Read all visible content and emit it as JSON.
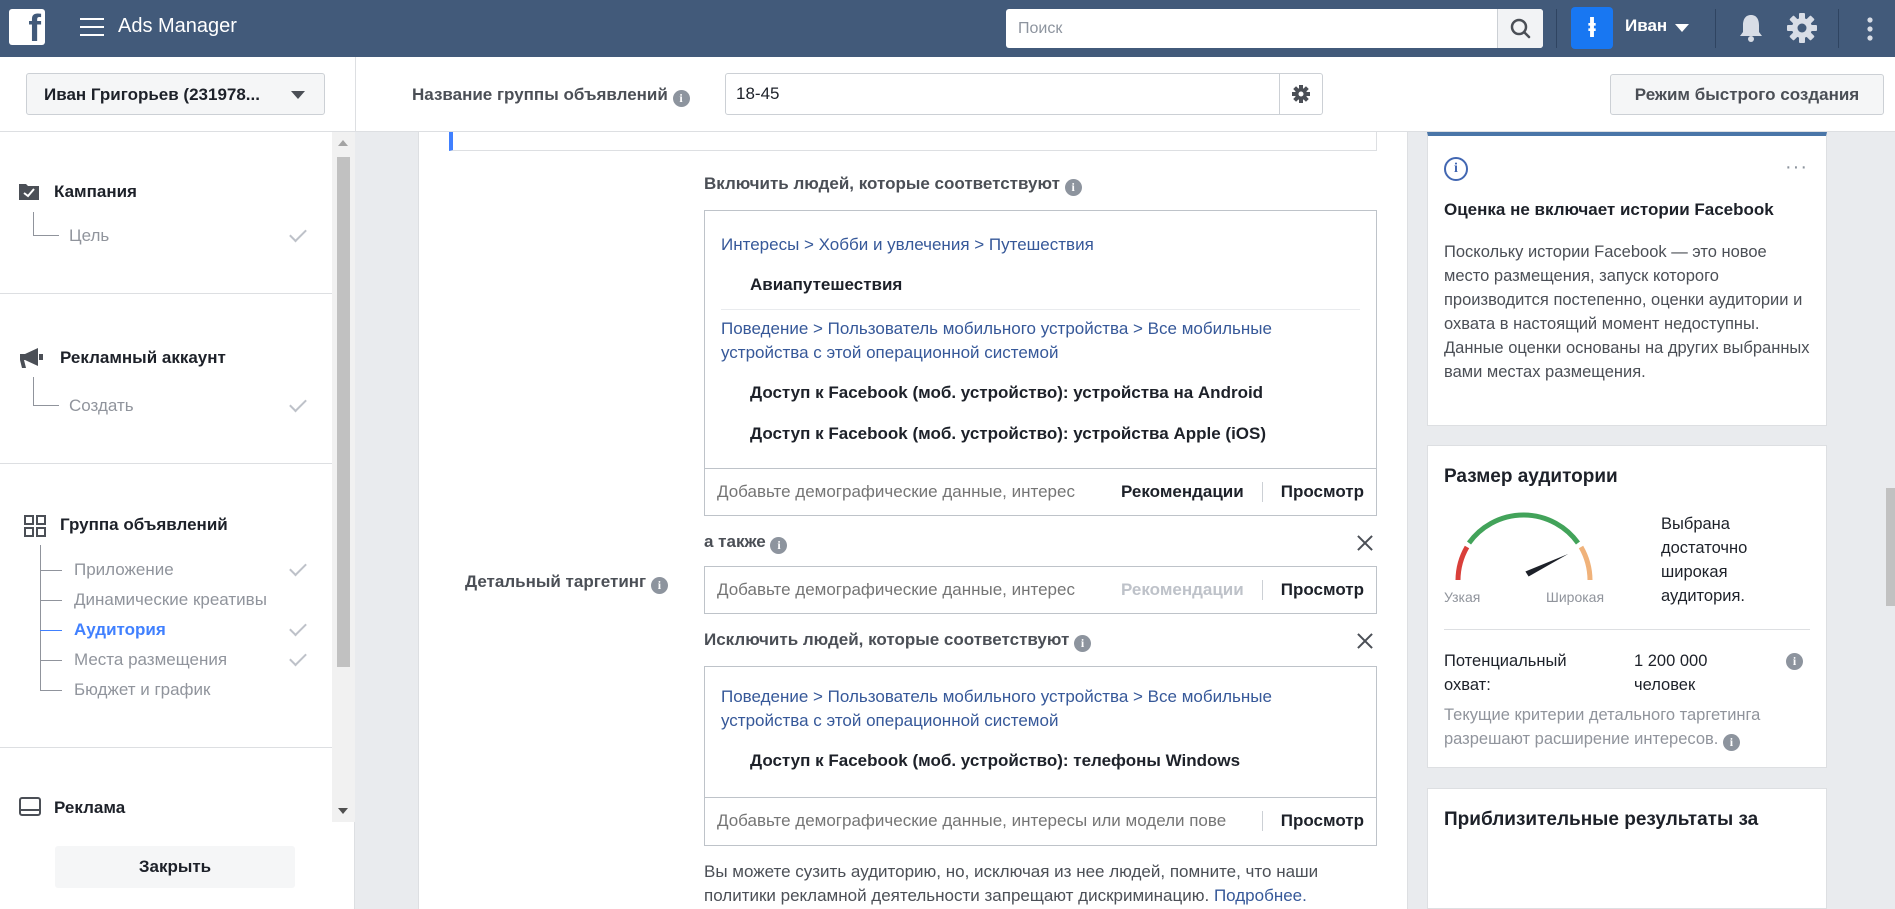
{
  "topbar": {
    "logo": "f",
    "app_title": "Ads Manager",
    "search_placeholder": "Поиск",
    "avatar_glyph": "ⱡ",
    "user_name": "Иван"
  },
  "subheader": {
    "account": "Иван Григорьев (231978...",
    "group_name_label": "Название группы объявлений",
    "group_name_value": "18-45",
    "quick_create": "Режим быстрого создания"
  },
  "sidebar": {
    "campaign": {
      "title": "Кампания",
      "items": [
        "Цель"
      ]
    },
    "ad_account": {
      "title": "Рекламный аккаунт",
      "items": [
        "Создать"
      ]
    },
    "ad_group": {
      "title": "Группа объявлений",
      "items": [
        "Приложение",
        "Динамические креативы",
        "Аудитория",
        "Места размещения",
        "Бюджет и график"
      ],
      "active": "Аудитория"
    },
    "ad": {
      "title": "Реклама"
    },
    "close_label": "Закрыть"
  },
  "main": {
    "include_title": "Включить людей, которые соответствуют",
    "include_paths": [
      {
        "path": "Интересы > Хобби и увлечения > Путешествия",
        "items": [
          "Авиапутешествия"
        ]
      },
      {
        "path": "Поведение > Пользователь мобильного устройства > Все мобильные устройства с этой операционной системой",
        "items": [
          "Доступ к Facebook (моб. устройство): устройства на Android",
          "Доступ к Facebook (моб. устройство): устройства Apple (iOS)"
        ]
      }
    ],
    "input_placeholder_short": "Добавьте демографические данные, интерес",
    "input_placeholder_long": "Добавьте демографические данные, интересы или модели пове",
    "recommendations": "Рекомендации",
    "browse": "Просмотр",
    "and_also": "а также",
    "detailed_targeting": "Детальный таргетинг",
    "exclude_title": "Исключить людей, которые соответствуют",
    "exclude_paths": [
      {
        "path": "Поведение > Пользователь мобильного устройства > Все мобильные устройства с этой операционной системой",
        "items": [
          "Доступ к Facebook (моб. устройство): телефоны Windows"
        ]
      }
    ],
    "note": "Вы можете сузить аудиторию, но, исключая из нее людей, помните, что наши политики рекламной деятельности запрещают дискриминацию.",
    "note_link": "Подробнее."
  },
  "right": {
    "card1_title": "Оценка не включает истории Facebook",
    "card1_text": "Поскольку истории Facebook — это новое место размещения, запуск которого производится постепенно, оценки аудитории и охвата в настоящий момент недоступны. Данные оценки основаны на других выбранных вами местах размещения.",
    "audience_title": "Размер аудитории",
    "gauge_narrow": "Узкая",
    "gauge_wide": "Широкая",
    "gauge_level": 0.82,
    "audience_status": "Выбрана достаточно широкая аудитория.",
    "reach_label": "Потенциальный охват:",
    "reach_value": "1 200 000 человек",
    "expansion_note": "Текущие критерии детального таргетинга разрешают расширение интересов.",
    "card3_title": "Приблизительные результаты за"
  },
  "colors": {
    "topbar": "#425a7a",
    "link": "#365899",
    "active": "#4080ff"
  }
}
